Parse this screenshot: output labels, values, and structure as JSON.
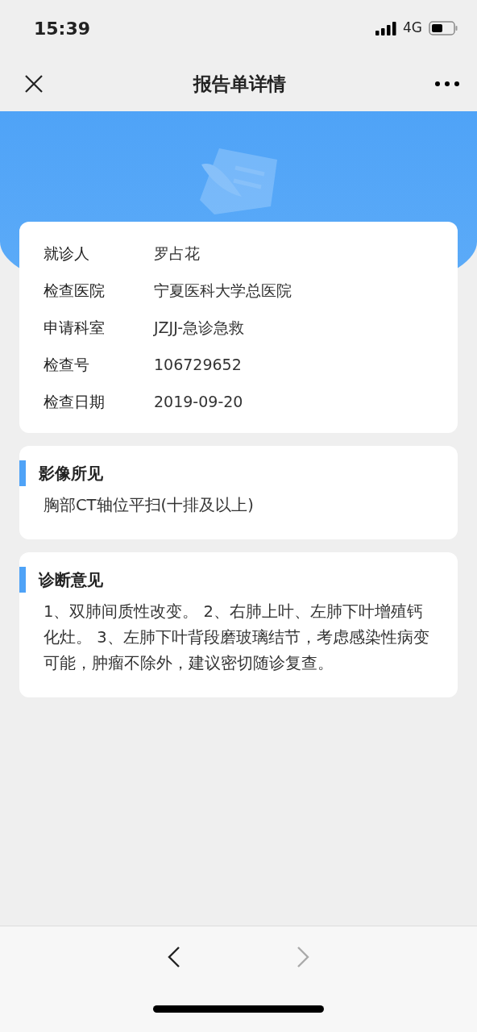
{
  "status_bar": {
    "time": "15:39",
    "network": "4G"
  },
  "nav_bar": {
    "title": "报告单详情"
  },
  "patient_info": [
    {
      "label": "就诊人",
      "value": "罗占花"
    },
    {
      "label": "检查医院",
      "value": "宁夏医科大学总医院"
    },
    {
      "label": "申请科室",
      "value": "JZJJ-急诊急救"
    },
    {
      "label": "检查号",
      "value": "106729652"
    },
    {
      "label": "检查日期",
      "value": "2019-09-20"
    }
  ],
  "sections": [
    {
      "title": "影像所见",
      "body": "胸部CT轴位平扫(十排及以上)"
    },
    {
      "title": "诊断意见",
      "body": "1、双肺间质性改变。 2、右肺上叶、左肺下叶增殖钙化灶。 3、左肺下叶背段磨玻璃结节，考虑感染性病变可能，肿瘤不除外，建议密切随诊复查。"
    }
  ],
  "bottom_bar": [
    {
      "kind": "back",
      "disabled": false
    },
    {
      "kind": "forward",
      "disabled": true
    }
  ]
}
